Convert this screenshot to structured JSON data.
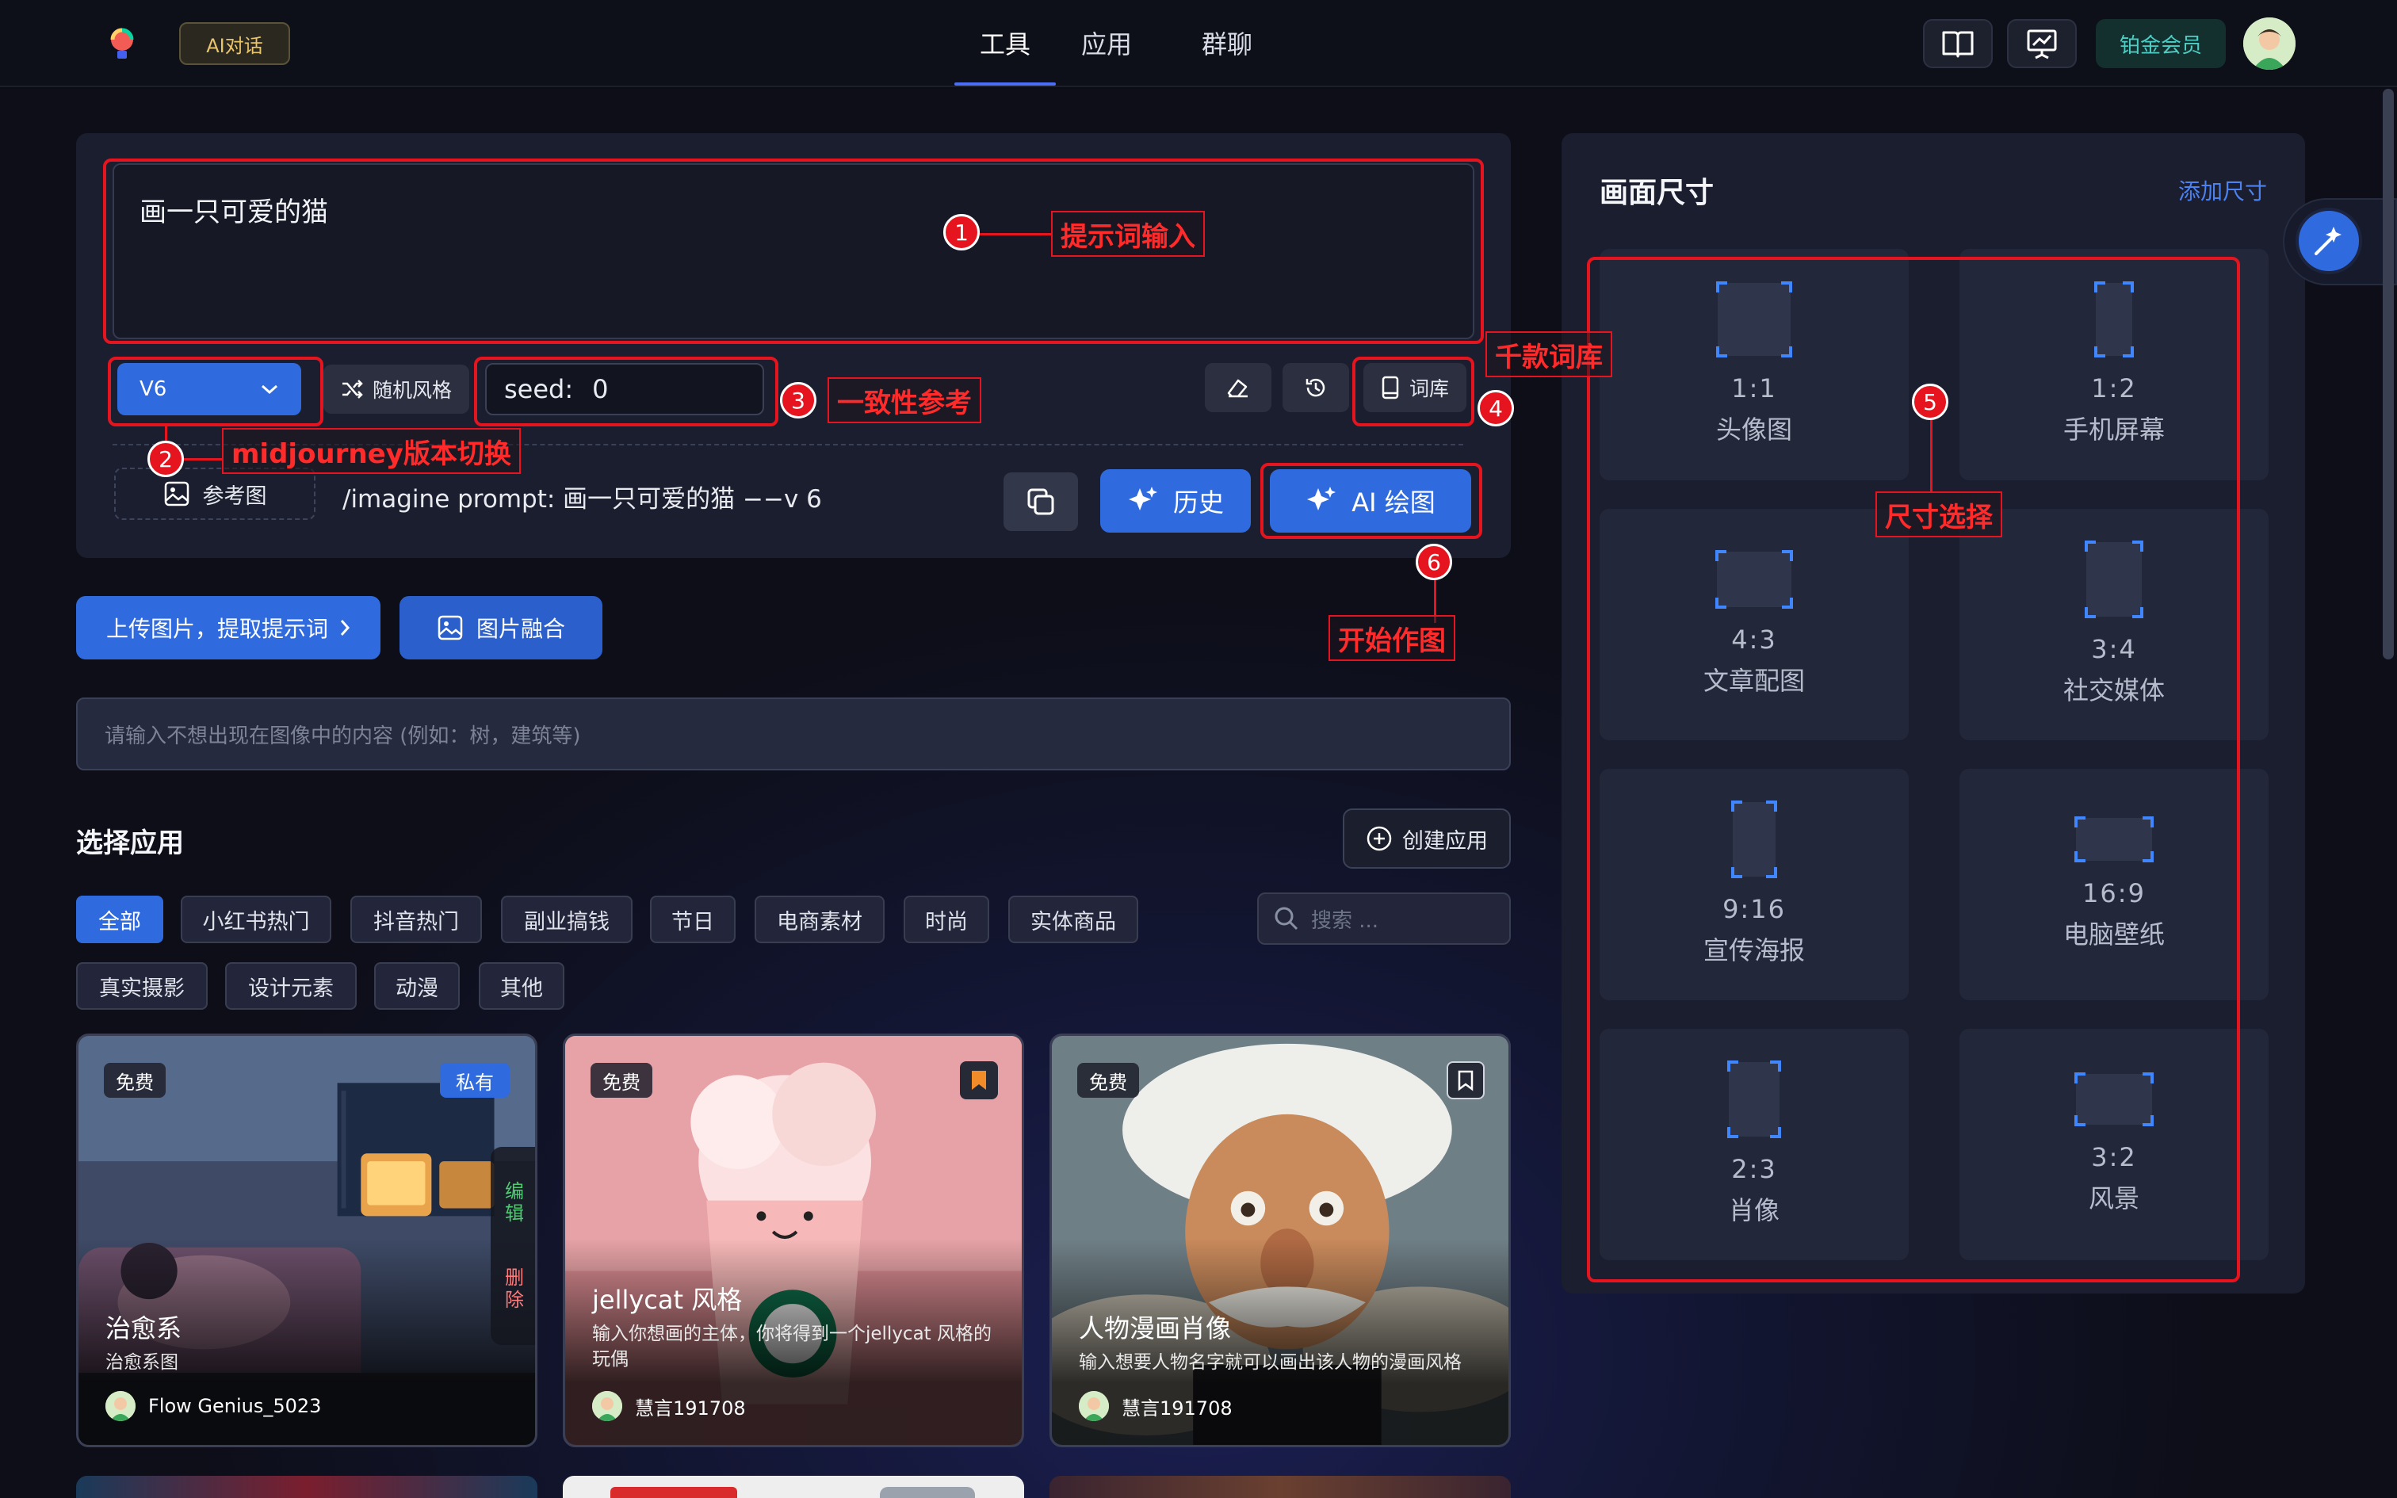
{
  "header": {
    "ai_chat_badge": "AI对话",
    "tabs": [
      {
        "label": "工具",
        "active": true
      },
      {
        "label": "应用",
        "active": false
      },
      {
        "label": "群聊",
        "active": false
      }
    ],
    "member_label": "铂金会员",
    "icons": [
      "book-icon",
      "presentation-icon"
    ]
  },
  "composer": {
    "prompt_value": "画一只可爱的猫",
    "version": "V6",
    "random_style_label": "随机风格",
    "seed_label": "seed:",
    "seed_value": "0",
    "library_label": "词库",
    "reference_label": "参考图",
    "command_preview": "/imagine prompt:  画一只可爱的猫 −−v 6",
    "history_label": "历史",
    "draw_label": "AI 绘图"
  },
  "actions": {
    "upload_label": "上传图片，提取提示词",
    "fuse_label": "图片融合",
    "negative_placeholder": "请输入不想出现在图像中的内容 (例如：树，建筑等)"
  },
  "apps": {
    "title": "选择应用",
    "create_label": "创建应用",
    "search_placeholder": "搜索 ...",
    "filters_row1": [
      {
        "label": "全部",
        "active": true
      },
      {
        "label": "小红书热门",
        "active": false
      },
      {
        "label": "抖音热门",
        "active": false
      },
      {
        "label": "副业搞钱",
        "active": false
      },
      {
        "label": "节日",
        "active": false
      },
      {
        "label": "电商素材",
        "active": false
      },
      {
        "label": "时尚",
        "active": false
      },
      {
        "label": "实体商品",
        "active": false
      }
    ],
    "filters_row2": [
      {
        "label": "真实摄影",
        "active": false
      },
      {
        "label": "设计元素",
        "active": false
      },
      {
        "label": "动漫",
        "active": false
      },
      {
        "label": "其他",
        "active": false
      }
    ],
    "cards": [
      {
        "tag": "免费",
        "private_tag": "私有",
        "title": "治愈系",
        "desc": "治愈系图",
        "author": "Flow Genius_5023",
        "edit_label": "编辑",
        "delete_label": "删除"
      },
      {
        "tag": "免费",
        "title": "jellycat 风格",
        "desc": "输入你想画的主体，你将得到一个jellycat 风格的玩偶",
        "author": "慧言191708",
        "bookmarked": true
      },
      {
        "tag": "免费",
        "title": "人物漫画肖像",
        "desc": "输入想要人物名字就可以画出该人物的漫画风格",
        "author": "慧言191708",
        "bookmarked": false
      }
    ]
  },
  "size_panel": {
    "title": "画面尺寸",
    "add_label": "添加尺寸",
    "sizes": [
      {
        "ratio": "1:1",
        "name": "头像图"
      },
      {
        "ratio": "1:2",
        "name": "手机屏幕"
      },
      {
        "ratio": "4:3",
        "name": "文章配图"
      },
      {
        "ratio": "3:4",
        "name": "社交媒体"
      },
      {
        "ratio": "9:16",
        "name": "宣传海报"
      },
      {
        "ratio": "16:9",
        "name": "电脑壁纸"
      },
      {
        "ratio": "2:3",
        "name": "肖像"
      },
      {
        "ratio": "3:2",
        "name": "风景"
      }
    ]
  },
  "annotations": {
    "a1": {
      "num": "1",
      "label": "提示词输入"
    },
    "a2": {
      "num": "2",
      "label": "midjourney版本切换"
    },
    "a3": {
      "num": "3",
      "label": "一致性参考"
    },
    "a4": {
      "num": "4",
      "label": "千款词库"
    },
    "a5": {
      "num": "5",
      "label": "尺寸选择"
    },
    "a6": {
      "num": "6",
      "label": "开始作图"
    }
  },
  "colors": {
    "accent": "#2f6bdf",
    "annotation": "#e5141e",
    "member": "#4ecdc4",
    "badge": "#e9c46a"
  }
}
